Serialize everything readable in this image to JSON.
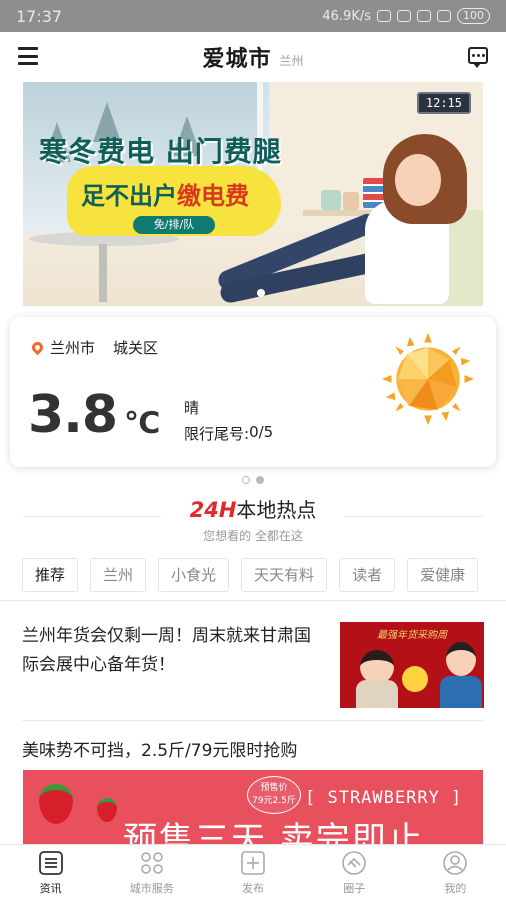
{
  "status_bar": {
    "time": "17:37",
    "network_speed": "46.9K/s",
    "battery": "100"
  },
  "header": {
    "title": "爱城市",
    "city": "兰州"
  },
  "banner": {
    "clock": "12:15",
    "headline": "寒冬费电 出门费腿",
    "sub_prefix": "足不出户",
    "sub_highlight": "缴电费",
    "pill": "免/排/队"
  },
  "weather": {
    "city": "兰州市",
    "district": "城关区",
    "temperature": "3.8",
    "unit": "℃",
    "condition": "晴",
    "limit_label": "限行尾号:",
    "limit_value": "0/5"
  },
  "hot": {
    "badge": "24H",
    "title": "本地热点",
    "subtitle": "您想看的 全都在这"
  },
  "chips": [
    "推荐",
    "兰州",
    "小食光",
    "天天有料",
    "读者",
    "爱健康"
  ],
  "news": [
    {
      "title": "兰州年货会仅剩一周！周末就来甘肃国际会展中心备年货！",
      "thumb_caption": "最强年货采购周"
    },
    {
      "title": "美味势不可挡，2.5斤/79元限时抢购"
    }
  ],
  "promo": {
    "tag_line1": "预售价",
    "tag_line2": "79元2.5斤",
    "english": "[ STRAWBERRY ]",
    "headline": "预售三天 卖完即止"
  },
  "tabbar": [
    {
      "label": "资讯",
      "icon": "news-icon"
    },
    {
      "label": "城市服务",
      "icon": "city-service-icon"
    },
    {
      "label": "发布",
      "icon": "publish-icon"
    },
    {
      "label": "圈子",
      "icon": "circle-icon"
    },
    {
      "label": "我的",
      "icon": "profile-icon"
    }
  ],
  "colors": {
    "accent_red": "#e02a2a",
    "pin_orange": "#f06a2c",
    "banner_teal": "#0f5e5a",
    "promo_red": "#e8505e"
  }
}
